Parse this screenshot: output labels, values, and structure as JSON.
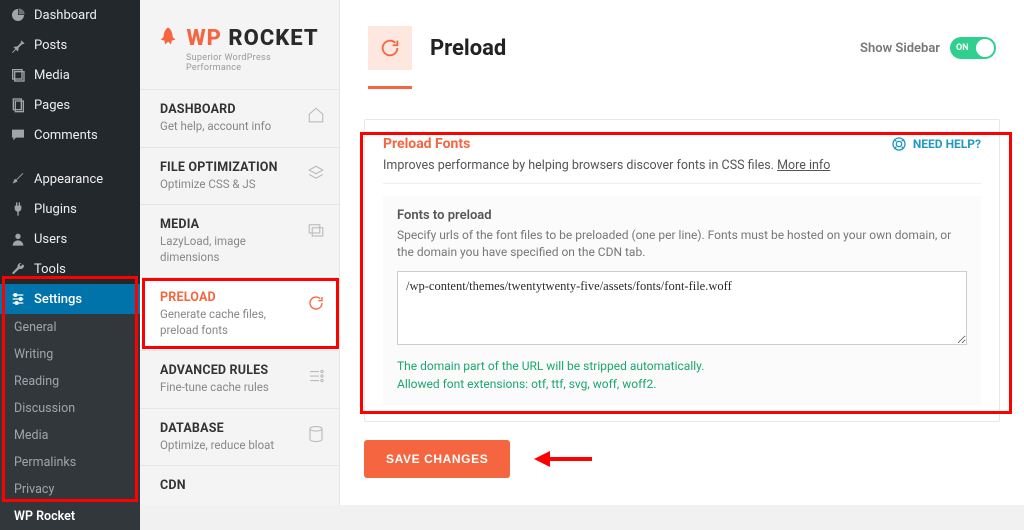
{
  "wp_sidebar": {
    "items": [
      {
        "label": "Dashboard",
        "icon": "dashboard"
      },
      {
        "label": "Posts",
        "icon": "pin"
      },
      {
        "label": "Media",
        "icon": "media"
      },
      {
        "label": "Pages",
        "icon": "page"
      },
      {
        "label": "Comments",
        "icon": "comment"
      },
      {
        "label": "Appearance",
        "icon": "brush"
      },
      {
        "label": "Plugins",
        "icon": "plug"
      },
      {
        "label": "Users",
        "icon": "user"
      },
      {
        "label": "Tools",
        "icon": "wrench"
      },
      {
        "label": "Settings",
        "icon": "sliders",
        "active": true
      }
    ],
    "sub": [
      {
        "label": "General"
      },
      {
        "label": "Writing"
      },
      {
        "label": "Reading"
      },
      {
        "label": "Discussion"
      },
      {
        "label": "Media"
      },
      {
        "label": "Permalinks"
      },
      {
        "label": "Privacy"
      },
      {
        "label": "WP Rocket",
        "active": true
      }
    ]
  },
  "rocket": {
    "brand_wp": "WP",
    "brand_rk": "ROCKET",
    "tagline": "Superior WordPress Performance",
    "nav": [
      {
        "title": "DASHBOARD",
        "desc": "Get help, account info",
        "icon": "home"
      },
      {
        "title": "FILE OPTIMIZATION",
        "desc": "Optimize CSS & JS",
        "icon": "layers"
      },
      {
        "title": "MEDIA",
        "desc": "LazyLoad, image dimensions",
        "icon": "images"
      },
      {
        "title": "PRELOAD",
        "desc": "Generate cache files, preload fonts",
        "icon": "refresh",
        "active": true
      },
      {
        "title": "ADVANCED RULES",
        "desc": "Fine-tune cache rules",
        "icon": "options"
      },
      {
        "title": "DATABASE",
        "desc": "Optimize, reduce bloat",
        "icon": "db"
      },
      {
        "title": "CDN",
        "desc": "",
        "icon": ""
      }
    ]
  },
  "header": {
    "title": "Preload",
    "show_sidebar_label": "Show Sidebar",
    "toggle_on": "ON"
  },
  "card": {
    "title": "Preload Fonts",
    "need_help": "NEED HELP?",
    "intro_text": "Improves performance by helping browsers discover fonts in CSS files. ",
    "more_info": "More info",
    "sub_title": "Fonts to preload",
    "sub_desc": "Specify urls of the font files to be preloaded (one per line). Fonts must be hosted on your own domain, or the domain you have specified on the CDN tab.",
    "textarea_value": "/wp-content/themes/twentytwenty-five/assets/fonts/font-file.woff",
    "hint1": "The domain part of the URL will be stripped automatically.",
    "hint2": "Allowed font extensions: otf, ttf, svg, woff, woff2."
  },
  "actions": {
    "save_label": "SAVE CHANGES"
  }
}
